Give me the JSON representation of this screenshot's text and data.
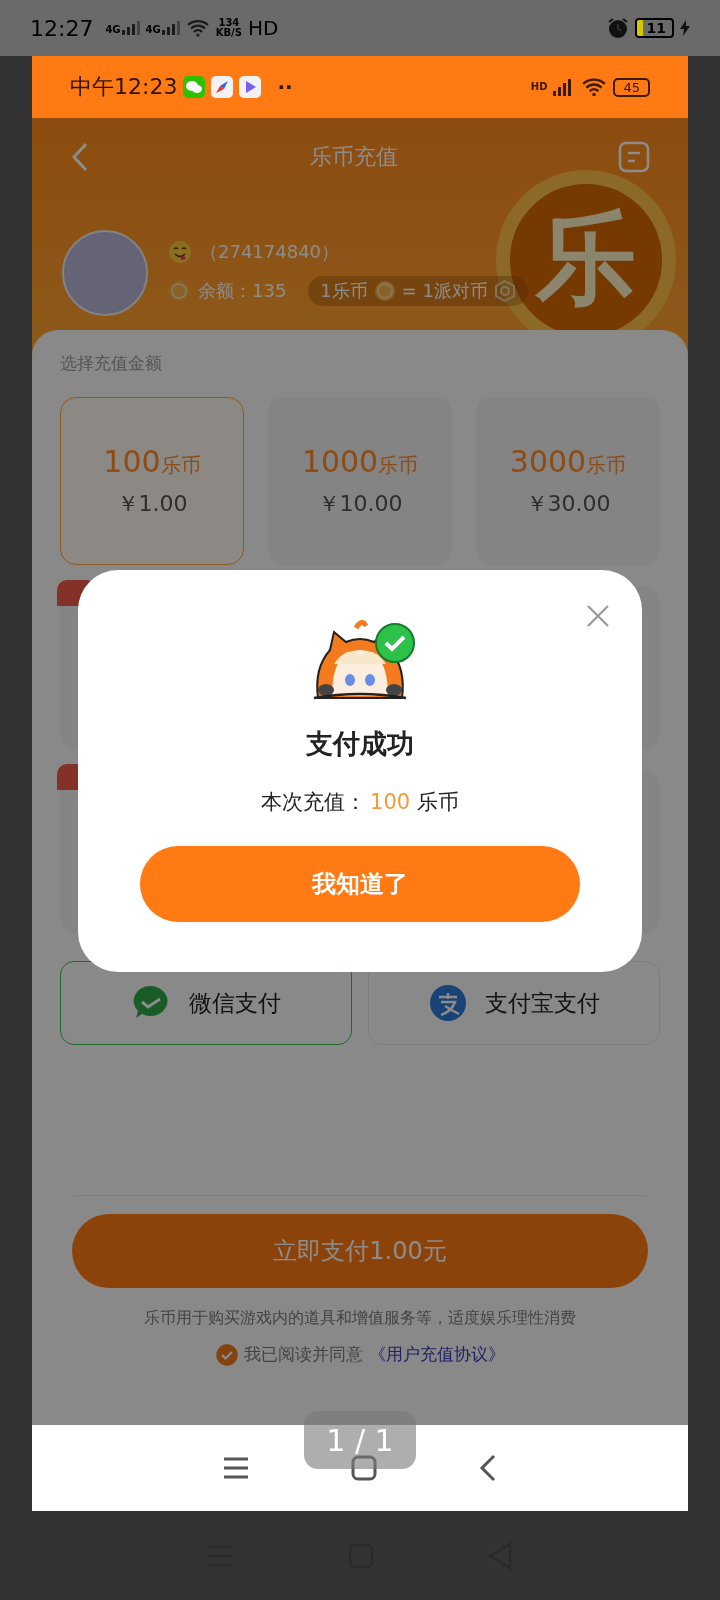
{
  "viewer_status_bar": {
    "time": "12:27",
    "signal_labels": [
      "4G",
      "4G"
    ],
    "speed": "134",
    "speed_unit": "KB/S",
    "hd": "HD",
    "battery": "11"
  },
  "status_bar": {
    "time": "中午12:23",
    "more": "··",
    "hd": "HD",
    "battery": "45"
  },
  "header": {
    "title": "乐币充值",
    "coin_mark": "乐"
  },
  "user": {
    "id": "（274174840）",
    "balance": "余额：135",
    "rate_left": "1乐币",
    "rate_right": "= 1派对币"
  },
  "amount_section": {
    "label": "选择充值金额",
    "options": [
      {
        "coins": "100",
        "unit": "乐币",
        "price": "￥1.00",
        "selected": true
      },
      {
        "coins": "1000",
        "unit": "乐币",
        "price": "￥10.00",
        "selected": false
      },
      {
        "coins": "3000",
        "unit": "乐币",
        "price": "￥30.00",
        "selected": false
      }
    ]
  },
  "payment_methods": [
    {
      "kind": "wechat",
      "label": "微信支付",
      "selected": true
    },
    {
      "kind": "alipay",
      "label": "支付宝支付",
      "selected": false
    }
  ],
  "pay_button": "立即支付1.00元",
  "notice": "乐币用于购买游戏内的道具和增值服务等，适度娱乐理性消费",
  "agreement": {
    "checked": true,
    "text": "我已阅读并同意",
    "link": "《用户充值协议》"
  },
  "dialog": {
    "title": "支付成功",
    "message_prefix": "本次充值：",
    "amount": "100",
    "unit": "乐币",
    "button": "我知道了"
  },
  "page_indicator": "1 / 1"
}
